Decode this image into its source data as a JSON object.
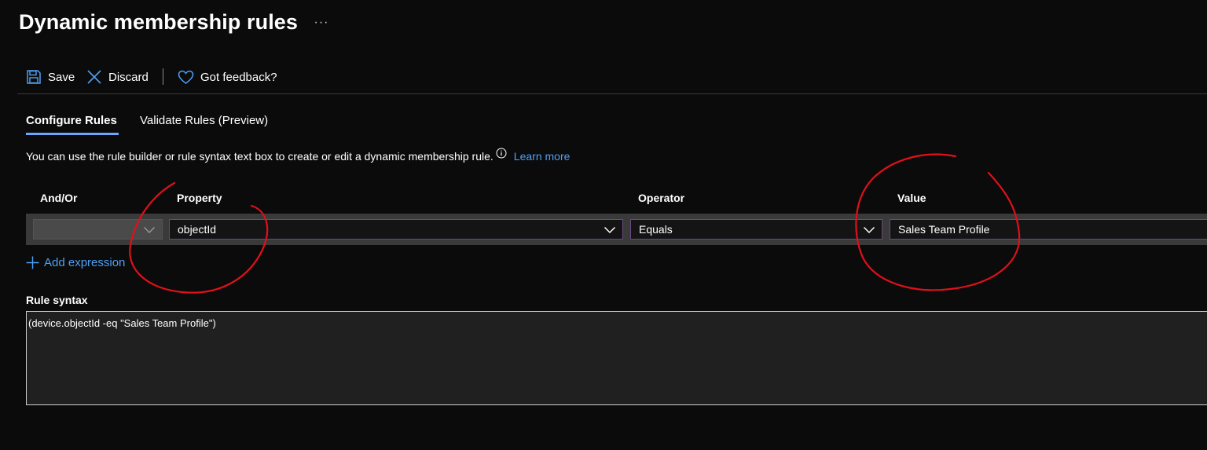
{
  "header": {
    "title": "Dynamic membership rules",
    "more_label": "···"
  },
  "toolbar": {
    "save_label": "Save",
    "discard_label": "Discard",
    "feedback_label": "Got feedback?"
  },
  "tabs": [
    {
      "label": "Configure Rules",
      "selected": true
    },
    {
      "label": "Validate Rules (Preview)",
      "selected": false
    }
  ],
  "description": {
    "text": "You can use the rule builder or rule syntax text box to create or edit a dynamic membership rule.",
    "link": "Learn more"
  },
  "grid": {
    "headers": {
      "and_or": "And/Or",
      "property": "Property",
      "operator": "Operator",
      "value": "Value"
    },
    "row": {
      "and_or": "",
      "property": "objectId",
      "operator": "Equals",
      "value": "Sales Team Profile"
    }
  },
  "add_expression_label": "Add expression",
  "rule_syntax": {
    "label": "Rule syntax",
    "value": "(device.objectId -eq \"Sales Team Profile\")"
  },
  "icons": {
    "save": "save-icon",
    "discard": "close-icon",
    "feedback": "heart-icon",
    "info": "info-icon",
    "add": "plus-icon",
    "dropdown": "chevron-down-icon"
  },
  "colors": {
    "background": "#0b0b0b",
    "accent": "#4ea1f5",
    "tab_underline": "#6aa7ff",
    "annotation": "#e0101a",
    "field_border": "#6a4a7c"
  }
}
